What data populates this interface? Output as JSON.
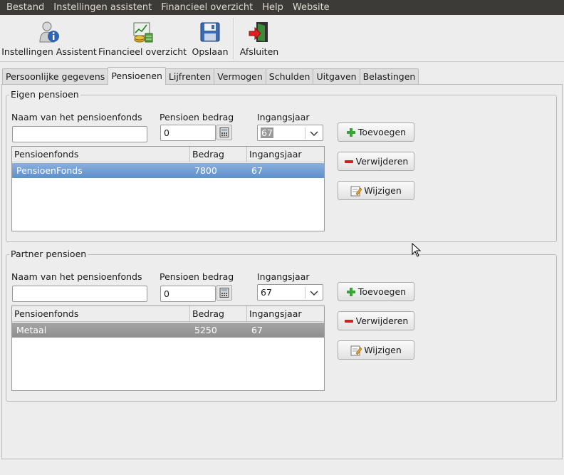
{
  "menu": [
    "Bestand",
    "Instellingen assistent",
    "Financieel overzicht",
    "Help",
    "Website"
  ],
  "toolbar": {
    "instellingen_label": "Instellingen Assistent",
    "financieel_label": "Financieel overzicht",
    "opslaan_label": "Opslaan",
    "afsluiten_label": "Afsluiten"
  },
  "tabs": [
    "Persoonlijke gegevens",
    "Pensioenen",
    "Lijfrenten",
    "Vermogen",
    "Schulden",
    "Uitgaven",
    "Belastingen"
  ],
  "active_tab": "Pensioenen",
  "eigen": {
    "title": "Eigen pensioen",
    "naam_label": "Naam van het pensioenfonds",
    "naam_value": "",
    "bedrag_label": "Pensioen bedrag",
    "bedrag_value": "0",
    "jaar_label": "Ingangsjaar",
    "jaar_value": "67",
    "columns": [
      "Pensioenfonds",
      "Bedrag",
      "Ingangsjaar"
    ],
    "rows": [
      {
        "fonds": "PensioenFonds",
        "bedrag": "7800",
        "jaar": "67"
      }
    ]
  },
  "partner": {
    "title": "Partner pensioen",
    "naam_label": "Naam van het pensioenfonds",
    "naam_value": "",
    "bedrag_label": "Pensioen bedrag",
    "bedrag_value": "0",
    "jaar_label": "Ingangsjaar",
    "jaar_value": "67",
    "columns": [
      "Pensioenfonds",
      "Bedrag",
      "Ingangsjaar"
    ],
    "rows": [
      {
        "fonds": "Metaal",
        "bedrag": "5250",
        "jaar": "67"
      }
    ]
  },
  "buttons": {
    "toevoegen": "Toevoegen",
    "verwijderen": "Verwijderen",
    "wijzigen": "Wijzigen"
  },
  "colors": {
    "menubar": "#3c3b37",
    "selection_focus": "#6f9bd2",
    "selection_nofocus": "#999999",
    "add_green": "#3aa23a",
    "remove_red": "#d02020"
  }
}
